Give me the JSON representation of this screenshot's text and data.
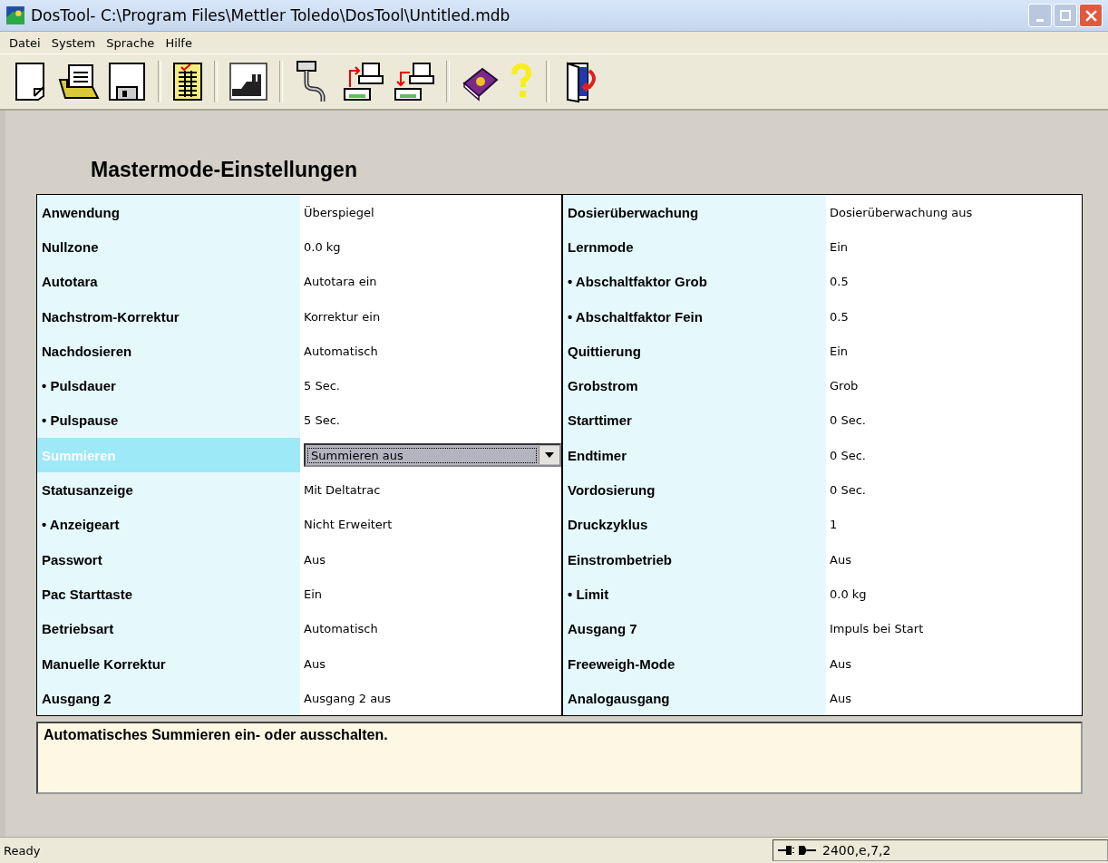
{
  "window": {
    "title": "DosTool-  C:\\Program Files\\Mettler Toledo\\DosTool\\Untitled.mdb"
  },
  "menu": [
    "Datei",
    "System",
    "Sprache",
    "Hilfe"
  ],
  "heading": "Mastermode-Einstellungen",
  "left": [
    {
      "label": "Anwendung",
      "value": "Überspiegel",
      "selected": false
    },
    {
      "label": "Nullzone",
      "value": "0.0 kg",
      "selected": false
    },
    {
      "label": "Autotara",
      "value": "Autotara ein",
      "selected": false
    },
    {
      "label": "Nachstrom-Korrektur",
      "value": "Korrektur ein",
      "selected": false
    },
    {
      "label": "Nachdosieren",
      "value": "Automatisch",
      "selected": false
    },
    {
      "label": "• Pulsdauer",
      "value": "5 Sec.",
      "selected": false
    },
    {
      "label": "• Pulspause",
      "value": "5 Sec.",
      "selected": false
    },
    {
      "label": "Summieren",
      "value": "Summieren aus",
      "selected": true
    },
    {
      "label": "Statusanzeige",
      "value": "Mit Deltatrac",
      "selected": false
    },
    {
      "label": "• Anzeigeart",
      "value": "Nicht Erweitert",
      "selected": false
    },
    {
      "label": "Passwort",
      "value": "Aus",
      "selected": false
    },
    {
      "label": "Pac Starttaste",
      "value": "Ein",
      "selected": false
    },
    {
      "label": "Betriebsart",
      "value": "Automatisch",
      "selected": false
    },
    {
      "label": "Manuelle Korrektur",
      "value": "Aus",
      "selected": false
    },
    {
      "label": "Ausgang 2",
      "value": "Ausgang 2 aus",
      "selected": false
    }
  ],
  "right": [
    {
      "label": "Dosierüberwachung",
      "value": "Dosierüberwachung aus",
      "selected": false
    },
    {
      "label": "Lernmode",
      "value": "Ein",
      "selected": false
    },
    {
      "label": "• Abschaltfaktor Grob",
      "value": "0.5",
      "selected": false
    },
    {
      "label": "• Abschaltfaktor Fein",
      "value": "0.5",
      "selected": false
    },
    {
      "label": "Quittierung",
      "value": "Ein",
      "selected": false
    },
    {
      "label": "Grobstrom",
      "value": "Grob",
      "selected": false
    },
    {
      "label": "Starttimer",
      "value": "0 Sec.",
      "selected": false
    },
    {
      "label": "Endtimer",
      "value": "0 Sec.",
      "selected": false
    },
    {
      "label": "Vordosierung",
      "value": "0 Sec.",
      "selected": false
    },
    {
      "label": "Druckzyklus",
      "value": "1",
      "selected": false
    },
    {
      "label": "Einstrombetrieb",
      "value": "Aus",
      "selected": false
    },
    {
      "label": "• Limit",
      "value": "0.0 kg",
      "selected": false
    },
    {
      "label": "Ausgang 7",
      "value": "Impuls bei Start",
      "selected": false
    },
    {
      "label": "Freeweigh-Mode",
      "value": "Aus",
      "selected": false
    },
    {
      "label": "Analogausgang",
      "value": "Aus",
      "selected": false
    }
  ],
  "help_text": "Automatisches Summieren ein- oder ausschalten.",
  "status_bar": {
    "status": "Ready",
    "connection": "2400,e,7,2"
  }
}
